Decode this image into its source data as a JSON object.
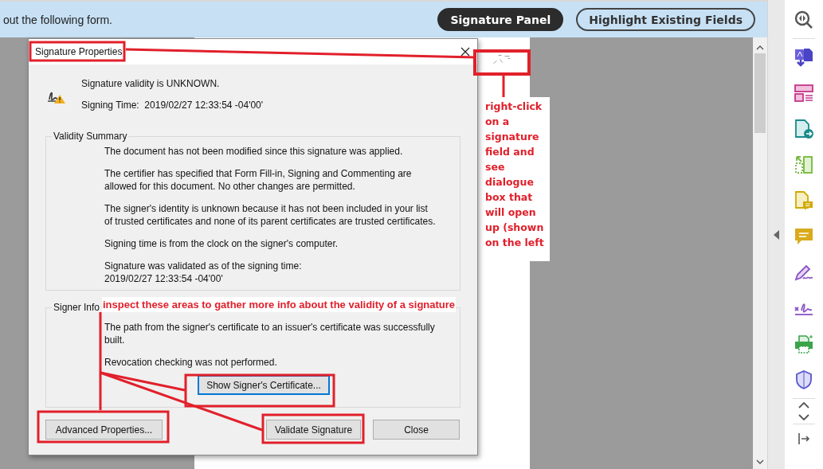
{
  "top_bar": {
    "instruction": "out the following form.",
    "buttons": [
      {
        "label": "Signature Panel",
        "kind": "filled"
      },
      {
        "label": "Highlight Existing Fields",
        "kind": "outlined"
      }
    ]
  },
  "dialog": {
    "title": "Signature Properties",
    "status_lines": [
      "Signature validity is UNKNOWN.",
      "Signing Time:  2019/02/27 12:33:54 -04'00'"
    ],
    "validity_summary": {
      "title": "Validity Summary",
      "paragraphs": [
        "The document has not been modified since this signature was applied.",
        "The certifier has specified that Form Fill-in, Signing and Commenting are allowed for this document. No other changes are permitted.",
        "The signer's identity is unknown because it has not been included in your list of trusted certificates and none of its parent certificates are trusted certificates.",
        "Signing time is from the clock on the signer's computer.",
        "Signature was validated as of the signing time:\n2019/02/27 12:33:54 -04'00'"
      ]
    },
    "signer_info": {
      "title": "Signer Info",
      "paragraphs": [
        "The path from the signer's certificate to an issuer's certificate was successfully built.",
        "Revocation checking was not performed."
      ],
      "button": {
        "label": "Show Signer's Certificate...",
        "focused": true
      }
    },
    "buttons": [
      {
        "label": "Advanced Properties..."
      },
      {
        "label": "Validate Signature"
      },
      {
        "label": "Close"
      }
    ]
  },
  "annotations": {
    "side_note": "right-click on a signature field and see dialogue box that will open up (shown on the left",
    "inline_note": "inspect these areas to gather more info about the validity of a signature"
  }
}
